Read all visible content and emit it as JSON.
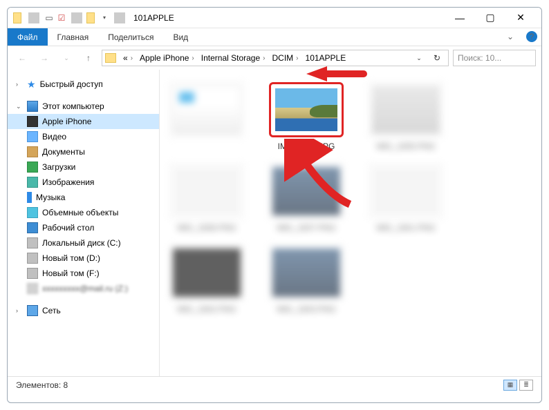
{
  "window": {
    "title": "101APPLE"
  },
  "ribbon": {
    "file": "Файл",
    "tabs": [
      "Главная",
      "Поделиться",
      "Вид"
    ]
  },
  "breadcrumb": {
    "prefix": "«",
    "segments": [
      "Apple iPhone",
      "Internal Storage",
      "DCIM",
      "101APPLE"
    ],
    "refresh_hint": "↻"
  },
  "search": {
    "placeholder": "Поиск: 10..."
  },
  "nav": {
    "quick_access": "Быстрый доступ",
    "this_pc": "Этот компьютер",
    "iphone": "Apple iPhone",
    "video": "Видео",
    "documents": "Документы",
    "downloads": "Загрузки",
    "pictures": "Изображения",
    "music": "Музыка",
    "objects3d": "Объемные объекты",
    "desktop": "Рабочий стол",
    "local_c": "Локальный диск (C:)",
    "new_d": "Новый том (D:)",
    "new_f": "Новый том (F:)",
    "mail_z": "xxxxxxxxx@mail.ru (Z:)",
    "network": "Сеть"
  },
  "files": {
    "selected_label": "IMG_1833.JPG",
    "items": [
      {
        "label": "",
        "style": "t-drive"
      },
      {
        "label": "IMG_1833.JPG",
        "style": "t-beach",
        "selected": true
      },
      {
        "label": "IMG_1835.PNG",
        "style": "t-screen1"
      },
      {
        "label": "IMG_1836.PNG",
        "style": "t-screen2"
      },
      {
        "label": "IMG_1837.PNG",
        "style": "t-coast"
      },
      {
        "label": "IMG_1841.PNG",
        "style": "t-screen2"
      },
      {
        "label": "IMG_1842.PNG",
        "style": "t-dark"
      },
      {
        "label": "IMG_1843.PNG",
        "style": "t-coast"
      }
    ]
  },
  "status": {
    "count_label": "Элементов: 8"
  }
}
